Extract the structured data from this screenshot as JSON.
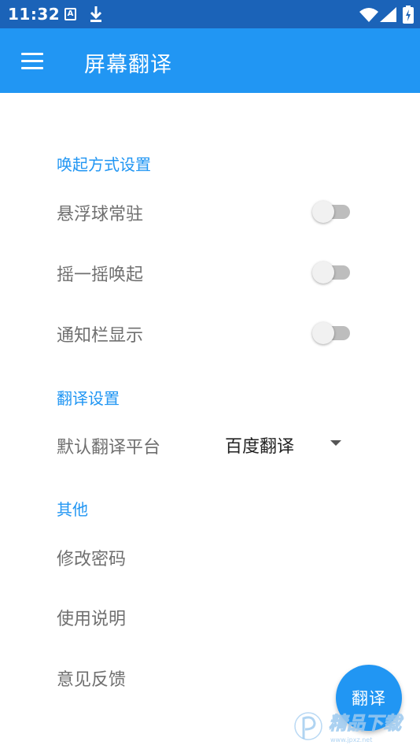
{
  "status_bar": {
    "time": "11:32",
    "notification_icons": [
      "a-notification-icon",
      "download-icon"
    ],
    "system_icons": [
      "wifi-icon",
      "signal-icon",
      "battery-icon"
    ]
  },
  "app_bar": {
    "title": "屏幕翻译",
    "menu_icon": "hamburger-menu-icon"
  },
  "sections": {
    "invoke": {
      "header": "唤起方式设置",
      "floating_ball": {
        "label": "悬浮球常驻",
        "checked": false
      },
      "shake": {
        "label": "摇一摇唤起",
        "checked": false
      },
      "notification": {
        "label": "通知栏显示",
        "checked": false
      }
    },
    "translate": {
      "header": "翻译设置",
      "platform": {
        "label": "默认翻译平台",
        "value": "百度翻译"
      }
    },
    "other": {
      "header": "其他",
      "change_password": "修改密码",
      "instructions": "使用说明",
      "feedback": "意见反馈"
    }
  },
  "fab": {
    "label": "翻译"
  },
  "colors": {
    "status_bar": "#1b63b8",
    "primary": "#2196f3",
    "row_text": "#6f6f6f",
    "switch_off_track": "#bdbdbd",
    "switch_off_thumb": "#f1f1f1"
  },
  "watermark": {
    "text": "精品下载"
  }
}
